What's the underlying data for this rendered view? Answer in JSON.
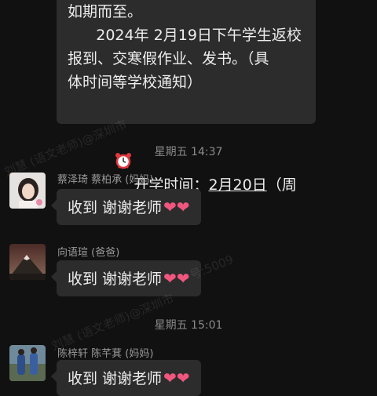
{
  "notice": {
    "line1": "如期而至。",
    "line2": "      2024年 2月19日下午学生返校",
    "line3": "报到、交寒假作业、发书。（具",
    "line4": "体时间等学校通知）",
    "school_start_label": "开学时间：",
    "school_start_date": "2月20日",
    "school_start_weekday": "（周二）",
    "alarm_icon": "alarm-clock-icon"
  },
  "timestamps": [
    "星期五 14:37",
    "星期五 15:01"
  ],
  "messages": [
    {
      "sender": "蔡泽琦 蔡柏承 (妈妈)",
      "text": "收到 谢谢老师"
    },
    {
      "sender": "向语瑄 (爸爸)",
      "text": "收到 谢谢老师"
    },
    {
      "sender": "陈梓轩 陈芊萁 (妈妈)",
      "text": "收到 谢谢老师"
    }
  ],
  "watermark": {
    "text_a": "刘慧 (语文老师)@深圳市",
    "text_b": "号:5009"
  },
  "colors": {
    "background": "#111111",
    "bubble": "#2c2c2c",
    "heart": "#f0567e"
  }
}
